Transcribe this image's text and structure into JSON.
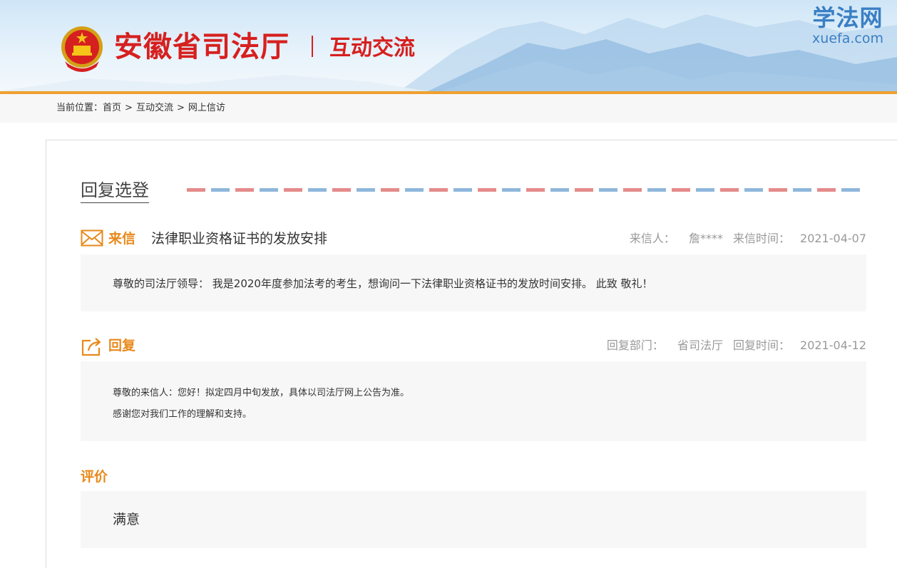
{
  "header": {
    "site_title": "安徽省司法厅",
    "site_subtitle": "互动交流",
    "xuefa_logo_cn": "学法网",
    "xuefa_logo_en": "xuefa.com",
    "emblem_icon": "national-emblem-icon"
  },
  "breadcrumb": {
    "prefix": "当前位置：",
    "items": [
      "首页",
      "互动交流",
      "网上信访"
    ],
    "separator": ">"
  },
  "section": {
    "heading": "回复选登"
  },
  "letter": {
    "label": "来信",
    "subject": "法律职业资格证书的发放安排",
    "sender_label": "来信人：",
    "sender": "詹****",
    "time_label": "来信时间：",
    "time": "2021-04-07",
    "content": "尊敬的司法厅领导： 我是2020年度参加法考的考生，想询问一下法律职业资格证书的发放时间安排。 此致 敬礼！",
    "icon": "envelope-icon"
  },
  "reply": {
    "label": "回复",
    "dept_label": "回复部门：",
    "dept": "省司法厅",
    "time_label": "回复时间：",
    "time": "2021-04-12",
    "lines": [
      "尊敬的来信人：您好！拟定四月中旬发放，具体以司法厅网上公告为准。",
      "感谢您对我们工作的理解和支持。"
    ],
    "icon": "share-reply-icon"
  },
  "evaluation": {
    "label": "评价",
    "value": "满意"
  },
  "colors": {
    "accent_orange": "#e8891b",
    "title_red": "#d6201f",
    "logo_blue": "#3a7fc4",
    "airmail_red": "#e58a8a",
    "airmail_blue": "#8fb7dc"
  }
}
